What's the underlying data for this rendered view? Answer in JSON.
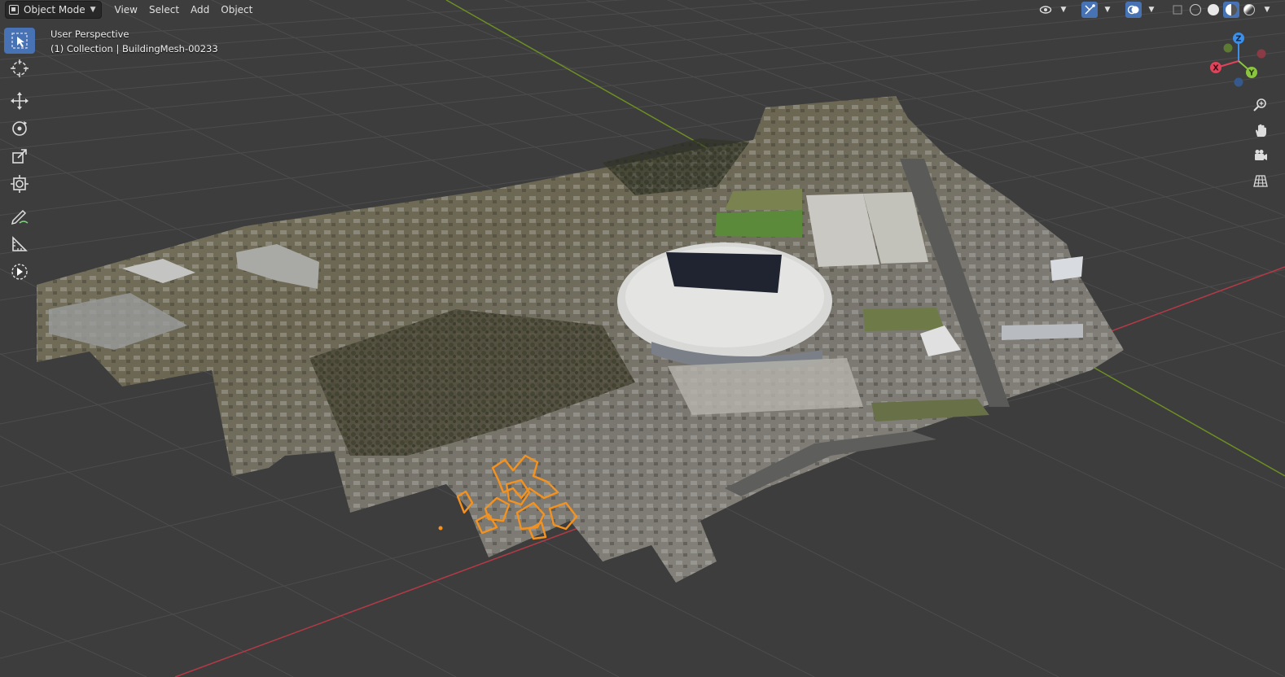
{
  "header": {
    "mode": "Object Mode",
    "menus": [
      "View",
      "Select",
      "Add",
      "Object"
    ]
  },
  "viewport": {
    "view_name": "User Perspective",
    "collection_info": "(1) Collection | BuildingMesh-00233"
  },
  "gizmo": {
    "x_label": "X",
    "y_label": "Y",
    "z_label": "Z",
    "x_color": "#e0435a",
    "y_color": "#8bc53f",
    "z_color": "#3b8fe8"
  },
  "colors": {
    "background": "#3d3d3d",
    "grid": "#4a4a4a",
    "active": "#4772b3",
    "selection_outline": "#f5921e",
    "x_axis": "#b43a46",
    "y_axis": "#6c8e23"
  },
  "toolbar": {
    "tools": [
      "select-box",
      "cursor",
      "move",
      "rotate",
      "scale",
      "transform",
      "annotate",
      "measure",
      "add-object"
    ]
  }
}
